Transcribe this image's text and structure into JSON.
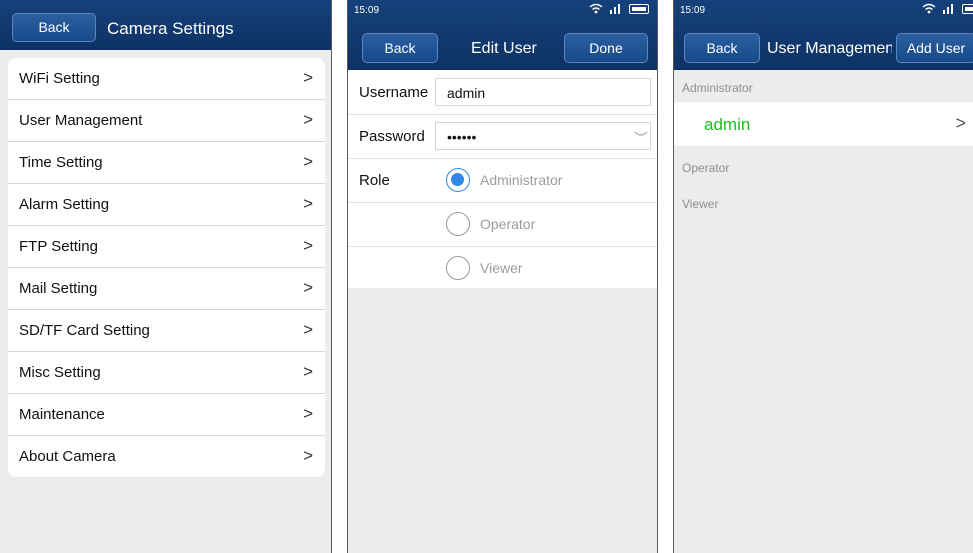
{
  "camera_settings": {
    "back_label": "Back",
    "title": "Camera Settings",
    "items": [
      {
        "label": "WiFi Setting"
      },
      {
        "label": "User Management"
      },
      {
        "label": "Time Setting"
      },
      {
        "label": "Alarm Setting"
      },
      {
        "label": "FTP Setting"
      },
      {
        "label": "Mail Setting"
      },
      {
        "label": "SD/TF Card Setting"
      },
      {
        "label": "Misc Setting"
      },
      {
        "label": "Maintenance"
      },
      {
        "label": "About Camera"
      }
    ],
    "chevron": ">"
  },
  "edit_user": {
    "status_time": "15:09",
    "back_label": "Back",
    "title": "Edit User",
    "done_label": "Done",
    "username_label": "Username",
    "username_value": "admin",
    "password_label": "Password",
    "password_value": "••••••",
    "role_label": "Role",
    "roles": [
      {
        "label": "Administrator",
        "selected": true
      },
      {
        "label": "Operator",
        "selected": false
      },
      {
        "label": "Viewer",
        "selected": false
      }
    ]
  },
  "user_management": {
    "status_time": "15:09",
    "back_label": "Back",
    "title": "User Managemen",
    "add_user_label": "Add User",
    "sections": {
      "administrator": "Administrator",
      "operator": "Operator",
      "viewer": "Viewer"
    },
    "admin_user": "admin",
    "chevron": ">"
  },
  "colors": {
    "navbar": "#16417a",
    "selected_radio": "#2d89e5",
    "admin_name": "#17c117"
  }
}
